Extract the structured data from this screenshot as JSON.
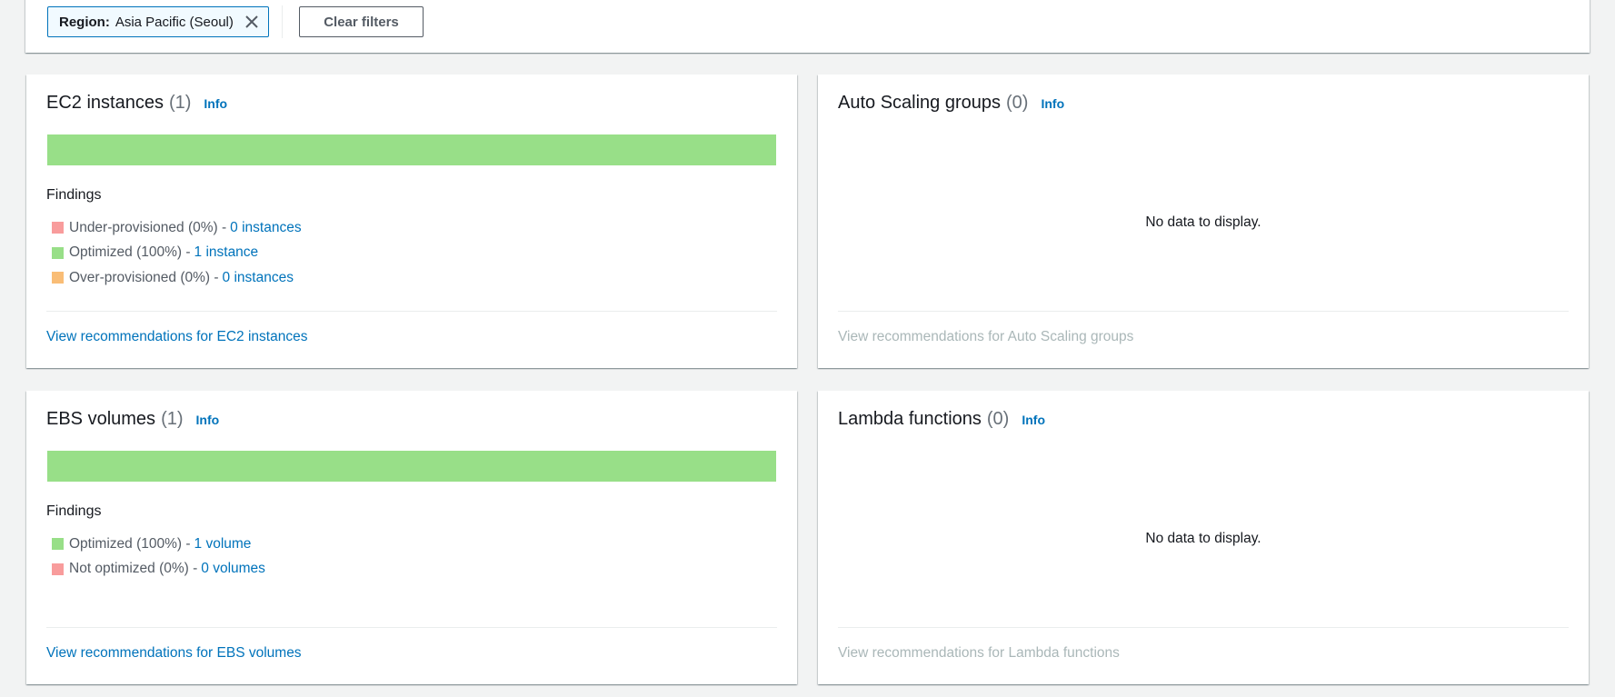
{
  "filter_bar": {
    "token": {
      "key": "Region:",
      "value": "Asia Pacific (Seoul)"
    },
    "clear_label": "Clear filters"
  },
  "colors": {
    "under_provisioned": "#f89c9c",
    "optimized": "#98df88",
    "over_provisioned": "#f9bd76",
    "not_optimized": "#f89c9c"
  },
  "cards": {
    "ec2": {
      "title": "EC2 instances",
      "count": "(1)",
      "info": "Info",
      "bar_optimized_fraction": 1.0,
      "findings_title": "Findings",
      "findings": [
        {
          "label": "Under-provisioned (0%) - ",
          "link": "0 instances",
          "color": "#f89c9c"
        },
        {
          "label": "Optimized (100%) - ",
          "link": "1 instance",
          "color": "#98df88"
        },
        {
          "label": "Over-provisioned (0%) - ",
          "link": "0 instances",
          "color": "#f9bd76"
        }
      ],
      "footer": "View recommendations for EC2 instances"
    },
    "asg": {
      "title": "Auto Scaling groups",
      "count": "(0)",
      "info": "Info",
      "empty": "No data to display.",
      "footer": "View recommendations for Auto Scaling groups"
    },
    "ebs": {
      "title": "EBS volumes",
      "count": "(1)",
      "info": "Info",
      "bar_optimized_fraction": 1.0,
      "findings_title": "Findings",
      "findings": [
        {
          "label": "Optimized (100%) - ",
          "link": "1 volume",
          "color": "#98df88"
        },
        {
          "label": "Not optimized (0%) - ",
          "link": "0 volumes",
          "color": "#f89c9c"
        }
      ],
      "footer": "View recommendations for EBS volumes"
    },
    "lambda": {
      "title": "Lambda functions",
      "count": "(0)",
      "info": "Info",
      "empty": "No data to display.",
      "footer": "View recommendations for Lambda functions"
    }
  }
}
